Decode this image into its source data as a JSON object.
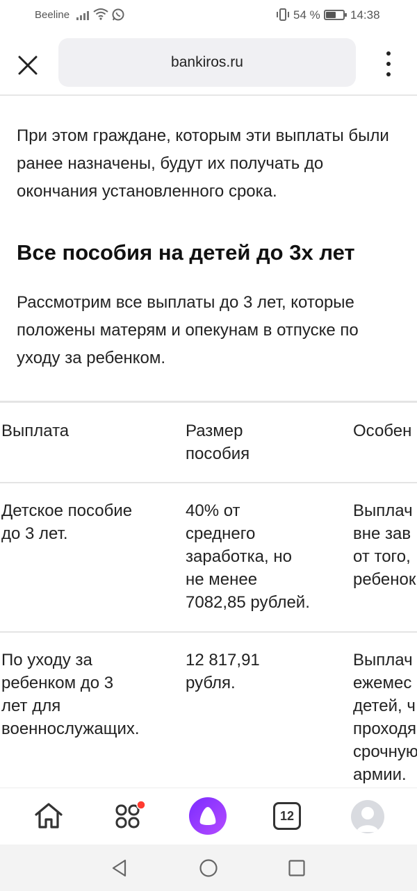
{
  "status_bar": {
    "carrier": "Beeline",
    "battery_percent": "54 %",
    "time": "14:38"
  },
  "browser": {
    "url": "bankiros.ru",
    "tabs_count": "12"
  },
  "article": {
    "paragraph_1": "При этом граждане, которым эти выплаты были ранее назначены, будут их получать до окончания установленного срока.",
    "heading": "Все пособия на детей до 3х лет",
    "paragraph_2": "Рассмотрим все выплаты до 3 лет, которые положены матерям и опекунам в отпуске по уходу за ребенком."
  },
  "table": {
    "headers": [
      "Выплата",
      "Размер\nпособия",
      "Особен"
    ],
    "rows": [
      [
        "Детское пособие\nдо 3 лет.",
        "40% от\nсреднего\nзаработка, но\nне менее\n7082,85 рублей.",
        "Выплач\nвне зав\nот того,\nребенок"
      ],
      [
        "По уходу за\nребенком до 3\nлет для\nвоеннослужащих.",
        "12 817,91\nрубля.",
        "Выплач\nежемес\nдетей, ч\nпроходя\nсрочную\nармии."
      ]
    ]
  },
  "icons": {
    "close": "close-icon",
    "menu": "more-vertical-icon",
    "home": "home-icon",
    "services": "grid-icon",
    "alice": "alice-icon",
    "tabs": "tabs-icon",
    "profile": "avatar-icon",
    "back": "back-triangle-icon",
    "home_sys": "home-circle-icon",
    "recents": "recents-square-icon"
  },
  "colors": {
    "alice_gradient_start": "#7b2cff",
    "alice_gradient_end": "#b44bff",
    "notification_dot": "#ff3b30"
  }
}
